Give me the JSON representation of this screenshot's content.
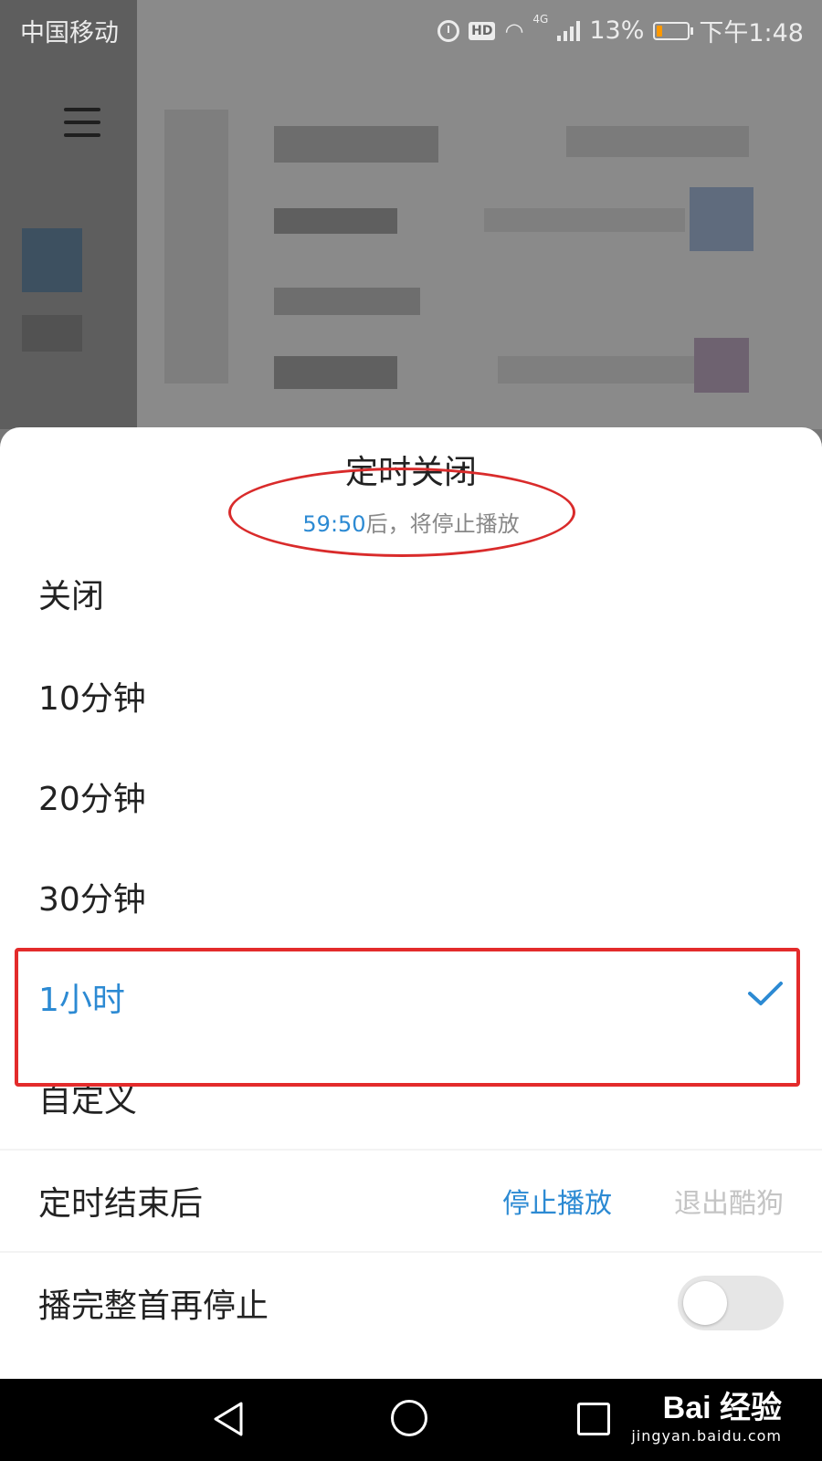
{
  "status_bar": {
    "carrier": "中国移动",
    "network": "4G",
    "battery": "13%",
    "time": "下午1:48"
  },
  "background": {
    "menu_icon": "hamburger-menu-icon"
  },
  "sheet": {
    "title": "定时关闭",
    "countdown": "59:50",
    "countdown_suffix": "后，将停止播放",
    "options": [
      {
        "label": "关闭",
        "selected": false
      },
      {
        "label": "10分钟",
        "selected": false
      },
      {
        "label": "20分钟",
        "selected": false
      },
      {
        "label": "30分钟",
        "selected": false
      },
      {
        "label": "1小时",
        "selected": true
      },
      {
        "label": "自定义",
        "selected": false
      }
    ],
    "after_timer": {
      "label": "定时结束后",
      "stop_label": "停止播放",
      "exit_label": "退出酷狗"
    },
    "finish_song": {
      "label": "播完整首再停止",
      "enabled": false
    }
  },
  "watermark": {
    "logo": "Bai 经验",
    "url": "jingyan.baidu.com"
  },
  "colors": {
    "accent": "#2c8ad3",
    "annotation_red": "#e32b2b",
    "battery_low": "#ff9900"
  }
}
